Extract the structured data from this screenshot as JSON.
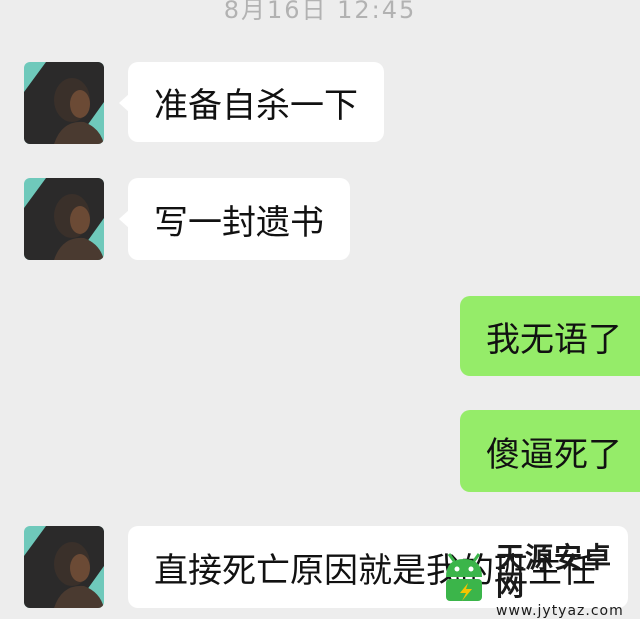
{
  "chat": {
    "timestamp": "8月16日 12:45",
    "messages": [
      {
        "sender": "contact",
        "text": "准备自杀一下"
      },
      {
        "sender": "contact",
        "text": "写一封遗书"
      },
      {
        "sender": "me",
        "text": "我无语了"
      },
      {
        "sender": "me",
        "text": "傻逼死了"
      },
      {
        "sender": "contact",
        "text": "直接死亡原因就是我的班主任"
      }
    ]
  },
  "watermark": {
    "name": "天源安卓网",
    "url": "www.jytyaz.com"
  },
  "colors": {
    "background": "#ededed",
    "incoming_bubble": "#ffffff",
    "outgoing_bubble": "#95ec69",
    "timestamp": "#b2b2b2"
  },
  "icons": {
    "avatar": "contact-avatar-photo",
    "watermark_logo": "android-robot-logo"
  }
}
